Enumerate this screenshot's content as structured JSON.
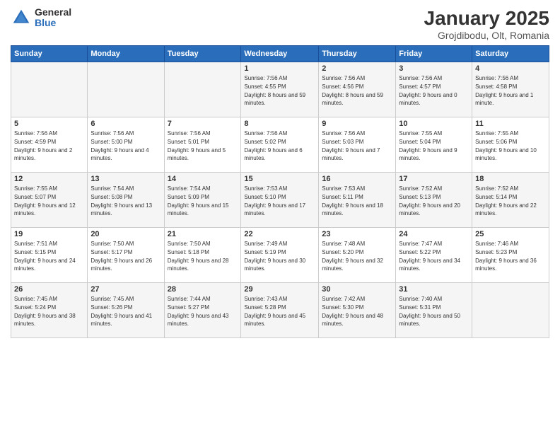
{
  "header": {
    "logo_general": "General",
    "logo_blue": "Blue",
    "title": "January 2025",
    "subtitle": "Grojdibodu, Olt, Romania"
  },
  "weekdays": [
    "Sunday",
    "Monday",
    "Tuesday",
    "Wednesday",
    "Thursday",
    "Friday",
    "Saturday"
  ],
  "weeks": [
    [
      {
        "day": "",
        "sunrise": "",
        "sunset": "",
        "daylight": ""
      },
      {
        "day": "",
        "sunrise": "",
        "sunset": "",
        "daylight": ""
      },
      {
        "day": "",
        "sunrise": "",
        "sunset": "",
        "daylight": ""
      },
      {
        "day": "1",
        "sunrise": "Sunrise: 7:56 AM",
        "sunset": "Sunset: 4:55 PM",
        "daylight": "Daylight: 8 hours and 59 minutes."
      },
      {
        "day": "2",
        "sunrise": "Sunrise: 7:56 AM",
        "sunset": "Sunset: 4:56 PM",
        "daylight": "Daylight: 8 hours and 59 minutes."
      },
      {
        "day": "3",
        "sunrise": "Sunrise: 7:56 AM",
        "sunset": "Sunset: 4:57 PM",
        "daylight": "Daylight: 9 hours and 0 minutes."
      },
      {
        "day": "4",
        "sunrise": "Sunrise: 7:56 AM",
        "sunset": "Sunset: 4:58 PM",
        "daylight": "Daylight: 9 hours and 1 minute."
      }
    ],
    [
      {
        "day": "5",
        "sunrise": "Sunrise: 7:56 AM",
        "sunset": "Sunset: 4:59 PM",
        "daylight": "Daylight: 9 hours and 2 minutes."
      },
      {
        "day": "6",
        "sunrise": "Sunrise: 7:56 AM",
        "sunset": "Sunset: 5:00 PM",
        "daylight": "Daylight: 9 hours and 4 minutes."
      },
      {
        "day": "7",
        "sunrise": "Sunrise: 7:56 AM",
        "sunset": "Sunset: 5:01 PM",
        "daylight": "Daylight: 9 hours and 5 minutes."
      },
      {
        "day": "8",
        "sunrise": "Sunrise: 7:56 AM",
        "sunset": "Sunset: 5:02 PM",
        "daylight": "Daylight: 9 hours and 6 minutes."
      },
      {
        "day": "9",
        "sunrise": "Sunrise: 7:56 AM",
        "sunset": "Sunset: 5:03 PM",
        "daylight": "Daylight: 9 hours and 7 minutes."
      },
      {
        "day": "10",
        "sunrise": "Sunrise: 7:55 AM",
        "sunset": "Sunset: 5:04 PM",
        "daylight": "Daylight: 9 hours and 9 minutes."
      },
      {
        "day": "11",
        "sunrise": "Sunrise: 7:55 AM",
        "sunset": "Sunset: 5:06 PM",
        "daylight": "Daylight: 9 hours and 10 minutes."
      }
    ],
    [
      {
        "day": "12",
        "sunrise": "Sunrise: 7:55 AM",
        "sunset": "Sunset: 5:07 PM",
        "daylight": "Daylight: 9 hours and 12 minutes."
      },
      {
        "day": "13",
        "sunrise": "Sunrise: 7:54 AM",
        "sunset": "Sunset: 5:08 PM",
        "daylight": "Daylight: 9 hours and 13 minutes."
      },
      {
        "day": "14",
        "sunrise": "Sunrise: 7:54 AM",
        "sunset": "Sunset: 5:09 PM",
        "daylight": "Daylight: 9 hours and 15 minutes."
      },
      {
        "day": "15",
        "sunrise": "Sunrise: 7:53 AM",
        "sunset": "Sunset: 5:10 PM",
        "daylight": "Daylight: 9 hours and 17 minutes."
      },
      {
        "day": "16",
        "sunrise": "Sunrise: 7:53 AM",
        "sunset": "Sunset: 5:11 PM",
        "daylight": "Daylight: 9 hours and 18 minutes."
      },
      {
        "day": "17",
        "sunrise": "Sunrise: 7:52 AM",
        "sunset": "Sunset: 5:13 PM",
        "daylight": "Daylight: 9 hours and 20 minutes."
      },
      {
        "day": "18",
        "sunrise": "Sunrise: 7:52 AM",
        "sunset": "Sunset: 5:14 PM",
        "daylight": "Daylight: 9 hours and 22 minutes."
      }
    ],
    [
      {
        "day": "19",
        "sunrise": "Sunrise: 7:51 AM",
        "sunset": "Sunset: 5:15 PM",
        "daylight": "Daylight: 9 hours and 24 minutes."
      },
      {
        "day": "20",
        "sunrise": "Sunrise: 7:50 AM",
        "sunset": "Sunset: 5:17 PM",
        "daylight": "Daylight: 9 hours and 26 minutes."
      },
      {
        "day": "21",
        "sunrise": "Sunrise: 7:50 AM",
        "sunset": "Sunset: 5:18 PM",
        "daylight": "Daylight: 9 hours and 28 minutes."
      },
      {
        "day": "22",
        "sunrise": "Sunrise: 7:49 AM",
        "sunset": "Sunset: 5:19 PM",
        "daylight": "Daylight: 9 hours and 30 minutes."
      },
      {
        "day": "23",
        "sunrise": "Sunrise: 7:48 AM",
        "sunset": "Sunset: 5:20 PM",
        "daylight": "Daylight: 9 hours and 32 minutes."
      },
      {
        "day": "24",
        "sunrise": "Sunrise: 7:47 AM",
        "sunset": "Sunset: 5:22 PM",
        "daylight": "Daylight: 9 hours and 34 minutes."
      },
      {
        "day": "25",
        "sunrise": "Sunrise: 7:46 AM",
        "sunset": "Sunset: 5:23 PM",
        "daylight": "Daylight: 9 hours and 36 minutes."
      }
    ],
    [
      {
        "day": "26",
        "sunrise": "Sunrise: 7:45 AM",
        "sunset": "Sunset: 5:24 PM",
        "daylight": "Daylight: 9 hours and 38 minutes."
      },
      {
        "day": "27",
        "sunrise": "Sunrise: 7:45 AM",
        "sunset": "Sunset: 5:26 PM",
        "daylight": "Daylight: 9 hours and 41 minutes."
      },
      {
        "day": "28",
        "sunrise": "Sunrise: 7:44 AM",
        "sunset": "Sunset: 5:27 PM",
        "daylight": "Daylight: 9 hours and 43 minutes."
      },
      {
        "day": "29",
        "sunrise": "Sunrise: 7:43 AM",
        "sunset": "Sunset: 5:28 PM",
        "daylight": "Daylight: 9 hours and 45 minutes."
      },
      {
        "day": "30",
        "sunrise": "Sunrise: 7:42 AM",
        "sunset": "Sunset: 5:30 PM",
        "daylight": "Daylight: 9 hours and 48 minutes."
      },
      {
        "day": "31",
        "sunrise": "Sunrise: 7:40 AM",
        "sunset": "Sunset: 5:31 PM",
        "daylight": "Daylight: 9 hours and 50 minutes."
      },
      {
        "day": "",
        "sunrise": "",
        "sunset": "",
        "daylight": ""
      }
    ]
  ]
}
